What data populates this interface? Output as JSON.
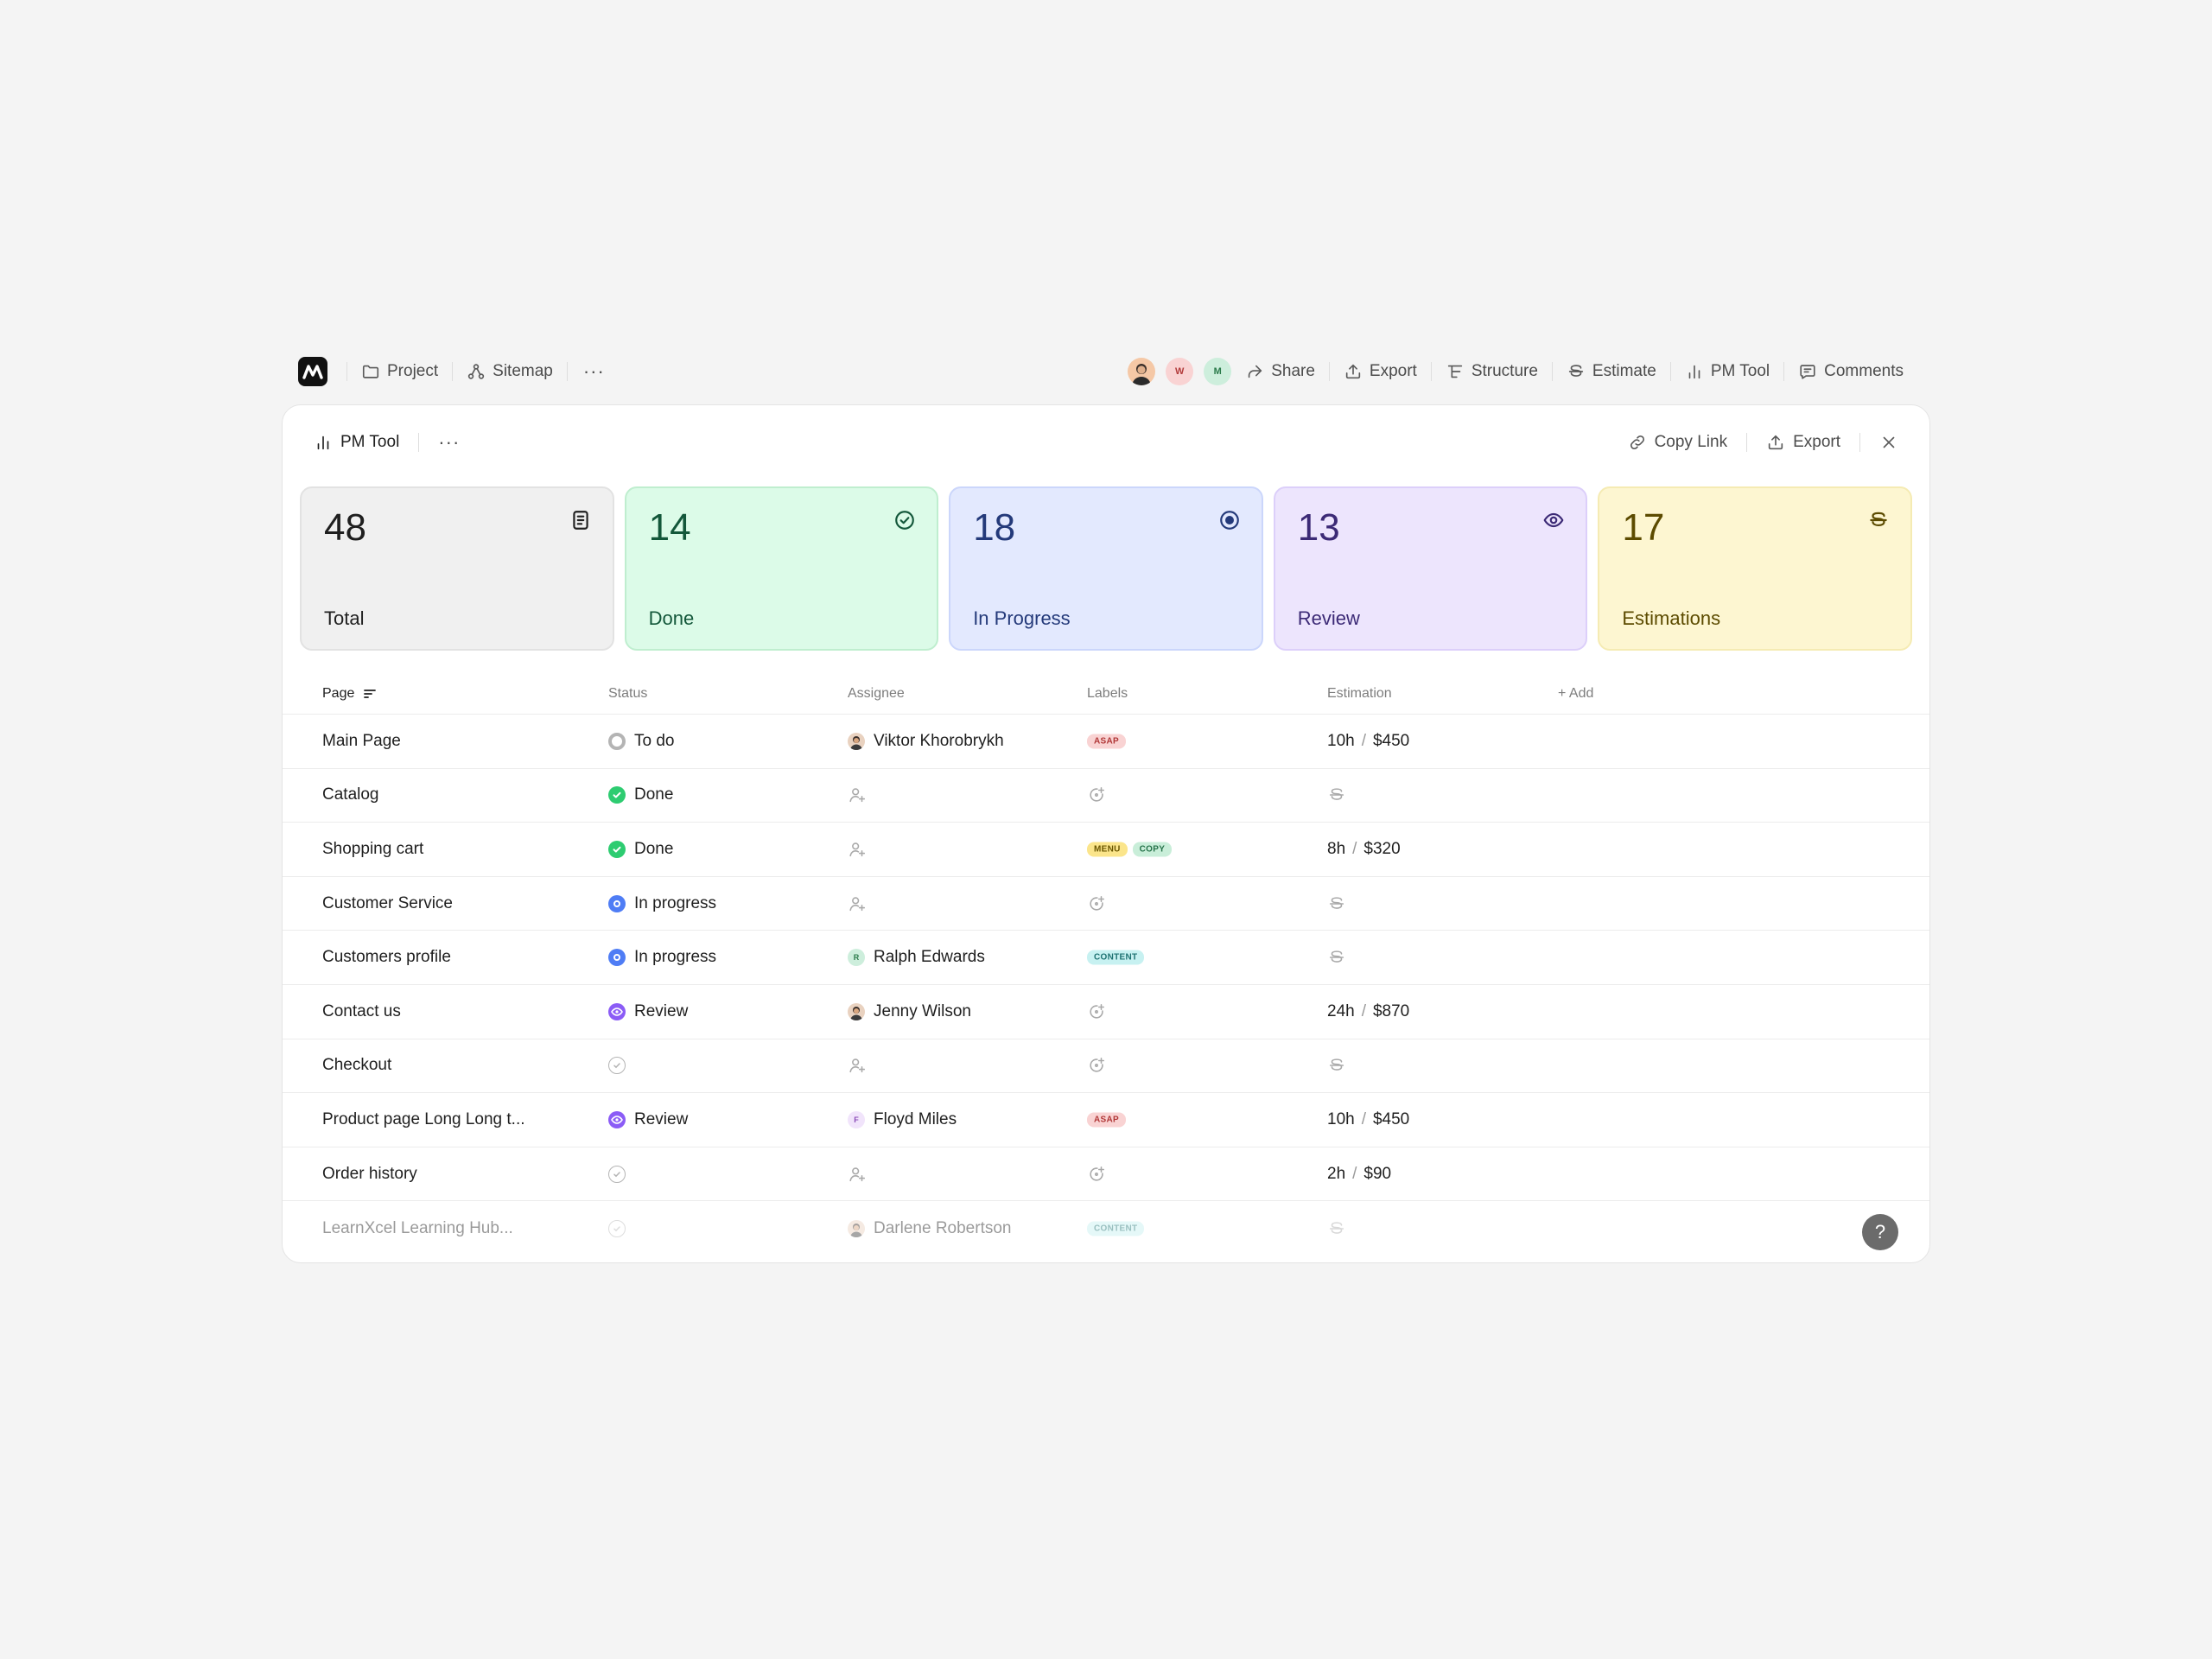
{
  "toolbar": {
    "project": "Project",
    "sitemap": "Sitemap",
    "more": "···",
    "avatars": [
      {
        "initial": "",
        "color": "#f5c8a6"
      },
      {
        "initial": "W",
        "color": "#f9d3d3"
      },
      {
        "initial": "M",
        "color": "#cdeedc"
      }
    ],
    "share": "Share",
    "export": "Export",
    "structure": "Structure",
    "estimate": "Estimate",
    "pm_tool": "PM Tool",
    "comments": "Comments"
  },
  "panel": {
    "title": "PM Tool",
    "more": "···",
    "copy_link": "Copy Link",
    "export": "Export",
    "close_icon": "close-icon"
  },
  "stats": [
    {
      "value": "48",
      "label": "Total",
      "icon": "document-icon",
      "bg": "#f0f0f0",
      "border": "#e2e2e2",
      "color": "#1f1f1f"
    },
    {
      "value": "14",
      "label": "Done",
      "icon": "check-circle-icon",
      "bg": "#dcfbe8",
      "border": "#bfeecf",
      "color": "#13573a"
    },
    {
      "value": "18",
      "label": "In Progress",
      "icon": "target-icon",
      "bg": "#e3e9fe",
      "border": "#cbd6fb",
      "color": "#243a7a"
    },
    {
      "value": "13",
      "label": "Review",
      "icon": "eye-icon",
      "bg": "#ede5fd",
      "border": "#dccffa",
      "color": "#3c2a76"
    },
    {
      "value": "17",
      "label": "Estimations",
      "icon": "dollar-icon",
      "bg": "#fdf6d1",
      "border": "#f5ebb3",
      "color": "#5c4b00"
    }
  ],
  "table": {
    "headers": {
      "page": "Page",
      "status": "Status",
      "assignee": "Assignee",
      "labels": "Labels",
      "estimation": "Estimation",
      "add": "+ Add"
    },
    "rows": [
      {
        "page": "Main Page",
        "status": "To do",
        "status_type": "todo",
        "assignee": "Viktor Khorobrykh",
        "assignee_avatar": "photo",
        "labels": [
          "ASAP"
        ],
        "hours": "10h",
        "cost": "$450"
      },
      {
        "page": "Catalog",
        "status": "Done",
        "status_type": "done",
        "assignee": "",
        "labels": [],
        "hours": "",
        "cost": ""
      },
      {
        "page": "Shopping cart",
        "status": "Done",
        "status_type": "done",
        "assignee": "",
        "labels": [
          "MENU",
          "COPY"
        ],
        "hours": "8h",
        "cost": "$320"
      },
      {
        "page": "Customer Service",
        "status": "In progress",
        "status_type": "progress",
        "assignee": "",
        "labels": [],
        "hours": "",
        "cost": ""
      },
      {
        "page": "Customers profile",
        "status": "In progress",
        "status_type": "progress",
        "assignee": "Ralph Edwards",
        "assignee_avatar": "R",
        "labels": [
          "CONTENT"
        ],
        "hours": "",
        "cost": ""
      },
      {
        "page": "Contact us",
        "status": "Review",
        "status_type": "review",
        "assignee": "Jenny Wilson",
        "assignee_avatar": "photo",
        "labels": [],
        "hours": "24h",
        "cost": "$870"
      },
      {
        "page": "Checkout",
        "status": "",
        "status_type": "empty",
        "assignee": "",
        "labels": [],
        "hours": "",
        "cost": ""
      },
      {
        "page": "Product page Long Long t...",
        "status": "Review",
        "status_type": "review",
        "assignee": "Floyd Miles",
        "assignee_avatar": "F",
        "labels": [
          "ASAP"
        ],
        "hours": "10h",
        "cost": "$450"
      },
      {
        "page": "Order history",
        "status": "",
        "status_type": "empty",
        "assignee": "",
        "labels": [],
        "hours": "2h",
        "cost": "$90"
      },
      {
        "page": "LearnXcel Learning Hub...",
        "status": "",
        "status_type": "empty",
        "assignee": "Darlene Robertson",
        "assignee_avatar": "photo",
        "labels": [
          "CONTENT"
        ],
        "hours": "",
        "cost": ""
      }
    ]
  },
  "help": "?"
}
